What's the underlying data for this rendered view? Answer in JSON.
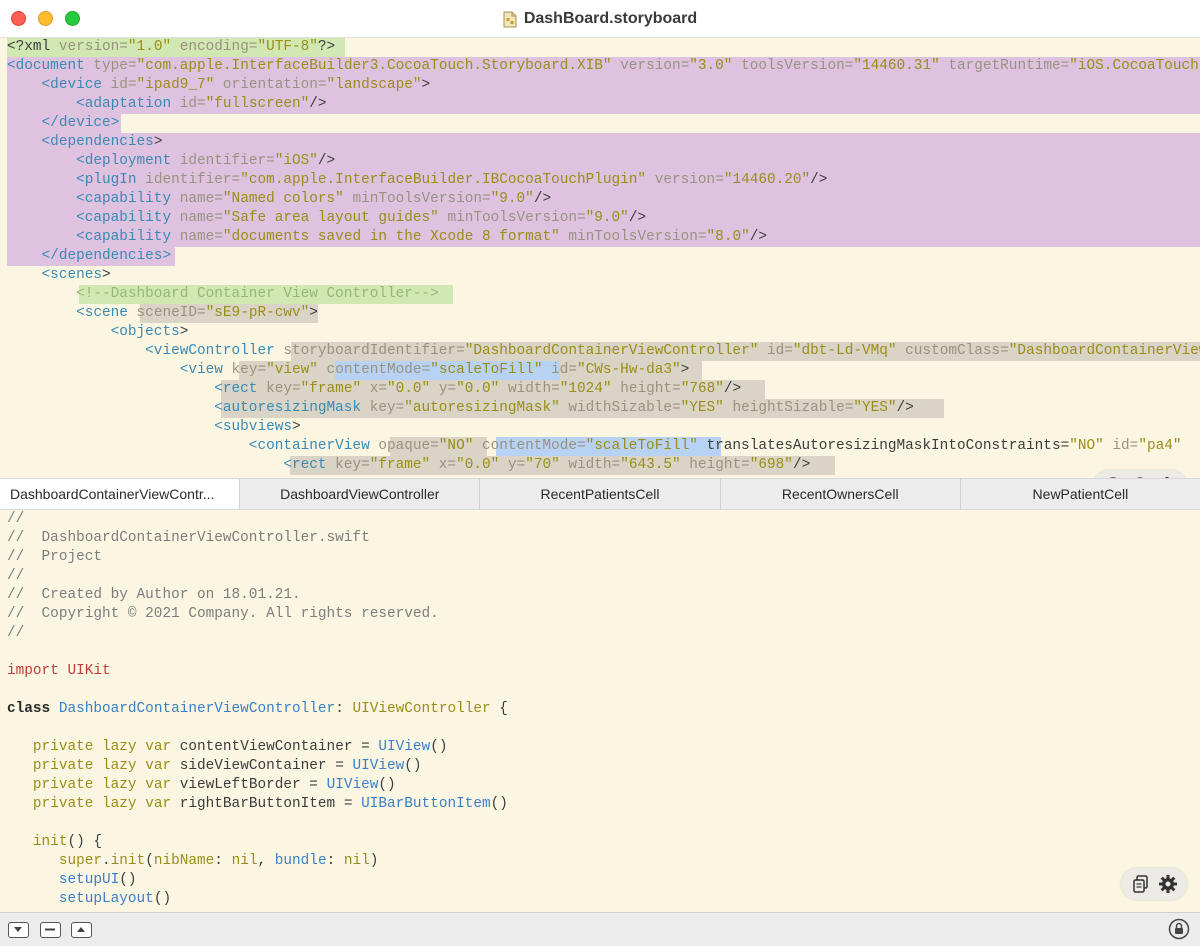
{
  "window": {
    "title": "DashBoard.storyboard",
    "icon": "storyboard-file-icon"
  },
  "xml_lines": [
    [
      [
        "p",
        "<?xml "
      ],
      [
        "a",
        "version="
      ],
      [
        "s",
        "\"1.0\""
      ],
      [
        "a",
        " encoding="
      ],
      [
        "s",
        "\"UTF-8\""
      ],
      [
        "p",
        "?>"
      ]
    ],
    [
      [
        "t",
        "<document"
      ],
      [
        "a",
        " type="
      ],
      [
        "s",
        "\"com.apple.InterfaceBuilder3.CocoaTouch.Storyboard.XIB\""
      ],
      [
        "a",
        " version="
      ],
      [
        "s",
        "\"3.0\""
      ],
      [
        "a",
        " toolsVersion="
      ],
      [
        "s",
        "\"14460.31\""
      ],
      [
        "a",
        " targetRuntime="
      ],
      [
        "s",
        "\"iOS.CocoaTouch\""
      ]
    ],
    [
      [
        "t",
        "    <device"
      ],
      [
        "a",
        " id="
      ],
      [
        "s",
        "\"ipad9_7\""
      ],
      [
        "a",
        " orientation="
      ],
      [
        "s",
        "\"landscape\""
      ],
      [
        "p",
        ">"
      ]
    ],
    [
      [
        "t",
        "        <adaptation"
      ],
      [
        "a",
        " id="
      ],
      [
        "s",
        "\"fullscreen\""
      ],
      [
        "p",
        "/>"
      ]
    ],
    [
      [
        "t",
        "    </device>"
      ]
    ],
    [
      [
        "t",
        "    <dependencies"
      ],
      [
        "p",
        ">"
      ]
    ],
    [
      [
        "t",
        "        <deployment"
      ],
      [
        "a",
        " identifier="
      ],
      [
        "s",
        "\"iOS\""
      ],
      [
        "p",
        "/>"
      ]
    ],
    [
      [
        "t",
        "        <plugIn"
      ],
      [
        "a",
        " identifier="
      ],
      [
        "s",
        "\"com.apple.InterfaceBuilder.IBCocoaTouchPlugin\""
      ],
      [
        "a",
        " version="
      ],
      [
        "s",
        "\"14460.20\""
      ],
      [
        "p",
        "/>"
      ]
    ],
    [
      [
        "t",
        "        <capability"
      ],
      [
        "a",
        " name="
      ],
      [
        "s",
        "\"Named colors\""
      ],
      [
        "a",
        " minToolsVersion="
      ],
      [
        "s",
        "\"9.0\""
      ],
      [
        "p",
        "/>"
      ]
    ],
    [
      [
        "t",
        "        <capability"
      ],
      [
        "a",
        " name="
      ],
      [
        "s",
        "\"Safe area layout guides\""
      ],
      [
        "a",
        " minToolsVersion="
      ],
      [
        "s",
        "\"9.0\""
      ],
      [
        "p",
        "/>"
      ]
    ],
    [
      [
        "t",
        "        <capability"
      ],
      [
        "a",
        " name="
      ],
      [
        "s",
        "\"documents saved in the Xcode 8 format\""
      ],
      [
        "a",
        " minToolsVersion="
      ],
      [
        "s",
        "\"8.0\""
      ],
      [
        "p",
        "/>"
      ]
    ],
    [
      [
        "t",
        "    </dependencies>"
      ]
    ],
    [
      [
        "t",
        "    <scenes"
      ],
      [
        "p",
        ">"
      ]
    ],
    [
      [
        "cm",
        "        <!--Dashboard Container View Controller-->"
      ]
    ],
    [
      [
        "t",
        "        <scene"
      ],
      [
        "a",
        " sceneID="
      ],
      [
        "s",
        "\"sE9-pR-cwv\""
      ],
      [
        "p",
        ">"
      ]
    ],
    [
      [
        "t",
        "            <objects"
      ],
      [
        "p",
        ">"
      ]
    ],
    [
      [
        "t",
        "                <viewController"
      ],
      [
        "a",
        " storyboardIdentifier="
      ],
      [
        "s",
        "\"DashboardContainerViewController\""
      ],
      [
        "a",
        " id="
      ],
      [
        "s",
        "\"dbt-Ld-VMq\""
      ],
      [
        "a",
        " customClass="
      ],
      [
        "s",
        "\"DashboardContainerViewController\""
      ]
    ],
    [
      [
        "t",
        "                    <view"
      ],
      [
        "a",
        " key="
      ],
      [
        "s",
        "\"view\""
      ],
      [
        "a",
        " contentMode="
      ],
      [
        "s",
        "\"scaleToFill\""
      ],
      [
        "a",
        " id="
      ],
      [
        "s",
        "\"CWs-Hw-da3\""
      ],
      [
        "p",
        ">"
      ]
    ],
    [
      [
        "t",
        "                        <rect"
      ],
      [
        "a",
        " key="
      ],
      [
        "s",
        "\"frame\""
      ],
      [
        "a",
        " x="
      ],
      [
        "s",
        "\"0.0\""
      ],
      [
        "a",
        " y="
      ],
      [
        "s",
        "\"0.0\""
      ],
      [
        "a",
        " width="
      ],
      [
        "s",
        "\"1024\""
      ],
      [
        "a",
        " height="
      ],
      [
        "s",
        "\"768\""
      ],
      [
        "p",
        "/>"
      ]
    ],
    [
      [
        "t",
        "                        <autoresizingMask"
      ],
      [
        "a",
        " key="
      ],
      [
        "s",
        "\"autoresizingMask\""
      ],
      [
        "a",
        " widthSizable="
      ],
      [
        "s",
        "\"YES\""
      ],
      [
        "a",
        " heightSizable="
      ],
      [
        "s",
        "\"YES\""
      ],
      [
        "p",
        "/>"
      ]
    ],
    [
      [
        "t",
        "                        <subviews"
      ],
      [
        "p",
        ">"
      ]
    ],
    [
      [
        "t",
        "                            <containerView"
      ],
      [
        "a",
        " opaque="
      ],
      [
        "s",
        "\"NO\""
      ],
      [
        "a",
        " contentMode="
      ],
      [
        "s",
        "\"scaleToFill\""
      ],
      [
        "p",
        " translatesAutoresizingMaskIntoConstraints="
      ],
      [
        "s",
        "\"NO\""
      ],
      [
        "a",
        " id="
      ],
      [
        "s",
        "\"pa4\""
      ]
    ],
    [
      [
        "t",
        "                                <rect"
      ],
      [
        "a",
        " key="
      ],
      [
        "s",
        "\"frame\""
      ],
      [
        "a",
        " x="
      ],
      [
        "s",
        "\"0.0\""
      ],
      [
        "a",
        " y="
      ],
      [
        "s",
        "\"70\""
      ],
      [
        "a",
        " width="
      ],
      [
        "s",
        "\"643.5\""
      ],
      [
        "a",
        " height="
      ],
      [
        "s",
        "\"698\""
      ],
      [
        "p",
        "/>"
      ]
    ]
  ],
  "tabs": [
    "DashboardContainerViewContr...",
    "DashboardViewController",
    "RecentPatientsCell",
    "RecentOwnersCell",
    "NewPatientCell"
  ],
  "code_lines": [
    [
      [
        "c",
        "//"
      ]
    ],
    [
      [
        "c",
        "//  DashboardContainerViewController.swift"
      ]
    ],
    [
      [
        "c",
        "//  Project"
      ]
    ],
    [
      [
        "c",
        "//"
      ]
    ],
    [
      [
        "c",
        "//  Created by Author on 18.01.21."
      ]
    ],
    [
      [
        "c",
        "//  Copyright © 2021 Company. All rights reserved."
      ]
    ],
    [
      [
        "c",
        "//"
      ]
    ],
    [],
    [
      [
        "kr",
        "import"
      ],
      [
        "p",
        " "
      ],
      [
        "kr",
        "UIKit"
      ]
    ],
    [],
    [
      [
        "kw",
        "class"
      ],
      [
        "p",
        " "
      ],
      [
        "ty",
        "DashboardContainerViewController"
      ],
      [
        "p",
        ": "
      ],
      [
        "kp",
        "UIViewController"
      ],
      [
        "p",
        " {"
      ]
    ],
    [],
    [
      [
        "kp",
        "   private"
      ],
      [
        "p",
        " "
      ],
      [
        "kp",
        "lazy"
      ],
      [
        "p",
        " "
      ],
      [
        "kp",
        "var"
      ],
      [
        "p",
        " contentViewContainer = "
      ],
      [
        "ty",
        "UIView"
      ],
      [
        "p",
        "()"
      ]
    ],
    [
      [
        "kp",
        "   private"
      ],
      [
        "p",
        " "
      ],
      [
        "kp",
        "lazy"
      ],
      [
        "p",
        " "
      ],
      [
        "kp",
        "var"
      ],
      [
        "p",
        " sideViewContainer = "
      ],
      [
        "ty",
        "UIView"
      ],
      [
        "p",
        "()"
      ]
    ],
    [
      [
        "kp",
        "   private"
      ],
      [
        "p",
        " "
      ],
      [
        "kp",
        "lazy"
      ],
      [
        "p",
        " "
      ],
      [
        "kp",
        "var"
      ],
      [
        "p",
        " viewLeftBorder = "
      ],
      [
        "ty",
        "UIView"
      ],
      [
        "p",
        "()"
      ]
    ],
    [
      [
        "kp",
        "   private"
      ],
      [
        "p",
        " "
      ],
      [
        "kp",
        "lazy"
      ],
      [
        "p",
        " "
      ],
      [
        "kp",
        "var"
      ],
      [
        "p",
        " rightBarButtonItem = "
      ],
      [
        "ty",
        "UIBarButtonItem"
      ],
      [
        "p",
        "()"
      ]
    ],
    [],
    [
      [
        "kp",
        "   init"
      ],
      [
        "p",
        "() {"
      ]
    ],
    [
      [
        "kp",
        "      super"
      ],
      [
        "p",
        "."
      ],
      [
        "kp",
        "init"
      ],
      [
        "p",
        "("
      ],
      [
        "kp",
        "nibName"
      ],
      [
        "p",
        ": "
      ],
      [
        "kp",
        "nil"
      ],
      [
        "p",
        ", "
      ],
      [
        "ty",
        "bundle"
      ],
      [
        "p",
        ": "
      ],
      [
        "kp",
        "nil"
      ],
      [
        "p",
        ")"
      ]
    ],
    [
      [
        "ty",
        "      setupUI"
      ],
      [
        "p",
        "()"
      ]
    ],
    [
      [
        "ty",
        "      setupLayout"
      ],
      [
        "p",
        "()"
      ]
    ]
  ],
  "icons": {
    "xml_pill": [
      "info-icon",
      "bulb-off-icon",
      "gear-icon"
    ],
    "code_pill": [
      "copy-icon",
      "gear-icon"
    ],
    "statusbar": [
      "collapse-down-icon",
      "minimize-icon",
      "expand-up-icon",
      "lock-icon"
    ]
  },
  "colors": {
    "tag": "#3a8ab5",
    "attribute": "#9a9280",
    "string": "#9a8e18",
    "comment": "#7d7d7d",
    "keyword": "#2a2a2a",
    "import": "#c23a3a",
    "type": "#3a7fc7",
    "highlight_purple": "#dec2df",
    "highlight_green": "#d1e8b3",
    "background": "#fbf6e2"
  }
}
